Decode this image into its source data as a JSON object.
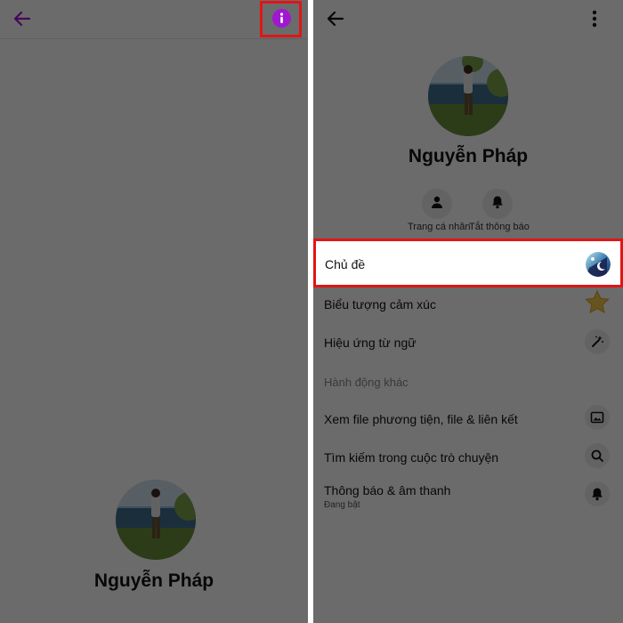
{
  "left": {
    "contact_name": "Nguyễn Pháp",
    "icons": {
      "back": "arrow-left-icon",
      "info": "info-icon"
    },
    "accent": "#a017d1"
  },
  "right": {
    "contact_name": "Nguyễn Pháp",
    "icons": {
      "back": "arrow-left-icon",
      "more": "more-vertical-icon"
    },
    "actions": [
      {
        "label": "Trang cá nhân",
        "icon": "person-icon"
      },
      {
        "label": "Tắt thông báo",
        "icon": "bell-icon"
      }
    ],
    "settings": {
      "theme": {
        "label": "Chủ đề",
        "icon": "theme-moon-icon"
      },
      "emoji": {
        "label": "Biểu tượng cảm xúc",
        "icon": "star-icon"
      },
      "word_effects": {
        "label": "Hiệu ứng từ ngữ",
        "icon": "magic-wand-icon"
      }
    },
    "more_actions_header": "Hành động khác",
    "more_actions": [
      {
        "label": "Xem file phương tiện, file & liên kết",
        "icon": "image-icon"
      },
      {
        "label": "Tìm kiếm trong cuộc trò chuyện",
        "icon": "search-icon"
      },
      {
        "label": "Thông báo & âm thanh",
        "sublabel": "Đang bật",
        "icon": "bell-icon"
      }
    ]
  },
  "highlight_color": "#e01515"
}
